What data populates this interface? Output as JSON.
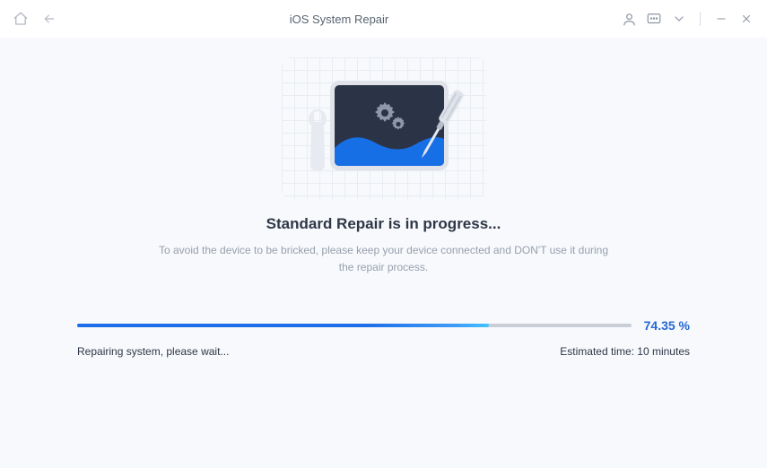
{
  "titlebar": {
    "title": "iOS System Repair"
  },
  "content": {
    "heading": "Standard Repair is in progress...",
    "subtext": "To avoid the device to be bricked, please keep your device connected and DON'T use it during the repair process."
  },
  "progress": {
    "percent_label": "74.35 %",
    "percent_value": 74.35,
    "status_text": "Repairing system, please wait...",
    "estimated_time": "Estimated time: 10 minutes"
  },
  "colors": {
    "accent": "#1d6ee8",
    "heading": "#2e3746"
  }
}
